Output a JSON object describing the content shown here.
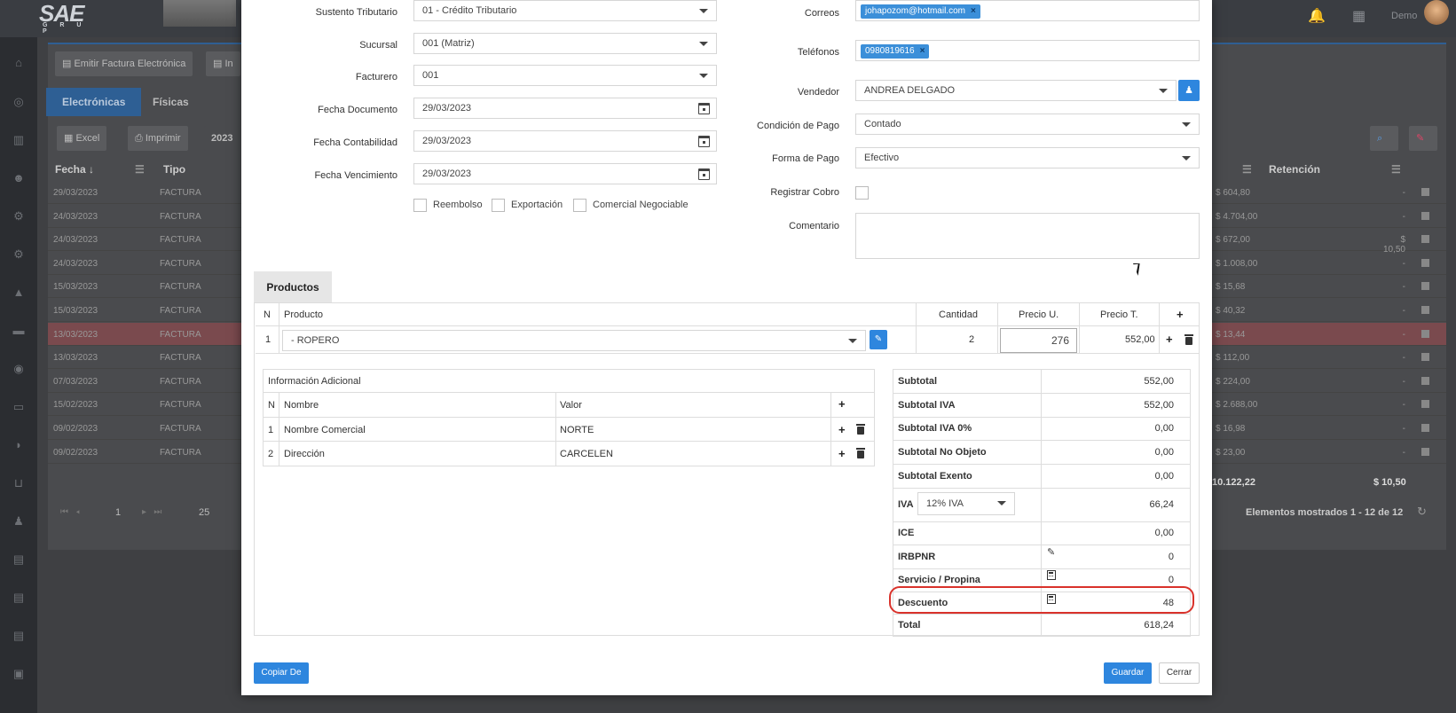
{
  "app": {
    "logo": "SAE",
    "logo_sub": "G R U P",
    "user": "Demo"
  },
  "background": {
    "buttons": [
      "Emitir Factura Electrónica",
      "In"
    ],
    "tabs": [
      "Electrónicas",
      "Físicas"
    ],
    "toolbar": [
      "Excel",
      "Imprimir",
      "2023"
    ],
    "headers": {
      "fecha": "Fecha ↓",
      "tipo": "Tipo",
      "retencion": "Retención"
    },
    "rows": [
      {
        "fecha": "29/03/2023",
        "tipo": "FACTURA",
        "total": "$ 604,80",
        "ret": "-"
      },
      {
        "fecha": "24/03/2023",
        "tipo": "FACTURA",
        "total": "$ 4.704,00",
        "ret": "-"
      },
      {
        "fecha": "24/03/2023",
        "tipo": "FACTURA",
        "total": "$ 672,00",
        "ret": "$ 10,50"
      },
      {
        "fecha": "24/03/2023",
        "tipo": "FACTURA",
        "total": "$ 1.008,00",
        "ret": "-"
      },
      {
        "fecha": "15/03/2023",
        "tipo": "FACTURA",
        "total": "$ 15,68",
        "ret": "-"
      },
      {
        "fecha": "15/03/2023",
        "tipo": "FACTURA",
        "total": "$ 40,32",
        "ret": "-"
      },
      {
        "fecha": "13/03/2023",
        "tipo": "FACTURA",
        "total": "$ 13,44",
        "ret": "-"
      },
      {
        "fecha": "13/03/2023",
        "tipo": "FACTURA",
        "total": "$ 112,00",
        "ret": "-"
      },
      {
        "fecha": "07/03/2023",
        "tipo": "FACTURA",
        "total": "$ 224,00",
        "ret": "-"
      },
      {
        "fecha": "15/02/2023",
        "tipo": "FACTURA",
        "total": "$ 2.688,00",
        "ret": "-"
      },
      {
        "fecha": "09/02/2023",
        "tipo": "FACTURA",
        "total": "$ 16,98",
        "ret": "-"
      },
      {
        "fecha": "09/02/2023",
        "tipo": "FACTURA",
        "total": "$ 23,00",
        "ret": "-"
      }
    ],
    "sum_total": "10.122,22",
    "sum_ret": "$ 10,50",
    "page": "1",
    "per_page": "25",
    "shown": "Elementos mostrados 1 - 12 de 12"
  },
  "form": {
    "left": [
      {
        "label": "Sustento Tributario",
        "value": "01 - Crédito Tributario"
      },
      {
        "label": "Sucursal",
        "value": "001 (Matriz)"
      },
      {
        "label": "Facturero",
        "value": "001"
      },
      {
        "label": "Fecha Documento",
        "value": "29/03/2023"
      },
      {
        "label": "Fecha Contabilidad",
        "value": "29/03/2023"
      },
      {
        "label": "Fecha Vencimiento",
        "value": "29/03/2023"
      }
    ],
    "checks": [
      "Reembolso",
      "Exportación",
      "Comercial Negociable"
    ],
    "correos_label": "Correos",
    "correo_chip": "johapozom@hotmail.com",
    "telefonos_label": "Teléfonos",
    "telefono_chip": "0980819616",
    "vendedor_label": "Vendedor",
    "vendedor": "ANDREA DELGADO",
    "condicion_label": "Condición de Pago",
    "condicion": "Contado",
    "forma_label": "Forma de Pago",
    "forma": "Efectivo",
    "registrar_label": "Registrar Cobro",
    "comentario_label": "Comentario"
  },
  "products": {
    "tab": "Productos",
    "headers": {
      "n": "N",
      "producto": "Producto",
      "cantidad": "Cantidad",
      "precio_u": "Precio U.",
      "precio_t": "Precio T."
    },
    "row": {
      "n": "1",
      "producto": "- ROPERO",
      "cantidad": "2",
      "precio_u": "276",
      "precio_t": "552,00"
    }
  },
  "info": {
    "title": "Información Adicional",
    "headers": {
      "n": "N",
      "nombre": "Nombre",
      "valor": "Valor"
    },
    "rows": [
      {
        "n": "1",
        "nombre": "Nombre Comercial",
        "valor": "NORTE"
      },
      {
        "n": "2",
        "nombre": "Dirección",
        "valor": "CARCELEN"
      }
    ]
  },
  "totals": {
    "subtotal": {
      "label": "Subtotal",
      "value": "552,00"
    },
    "subtotal_iva": {
      "label": "Subtotal IVA",
      "value": "552,00"
    },
    "subtotal_iva0": {
      "label": "Subtotal IVA 0%",
      "value": "0,00"
    },
    "subtotal_no": {
      "label": "Subtotal No Objeto",
      "value": "0,00"
    },
    "subtotal_ex": {
      "label": "Subtotal Exento",
      "value": "0,00"
    },
    "iva": {
      "label": "IVA",
      "select": "12% IVA",
      "value": "66,24"
    },
    "ice": {
      "label": "ICE",
      "value": "0,00"
    },
    "irbpnr": {
      "label": "IRBPNR",
      "value": "0"
    },
    "servicio": {
      "label": "Servicio / Propina",
      "value": "0"
    },
    "descuento": {
      "label": "Descuento",
      "value": "48"
    },
    "total": {
      "label": "Total",
      "value": "618,24"
    }
  },
  "footer": {
    "copiar": "Copiar De",
    "guardar": "Guardar",
    "cerrar": "Cerrar"
  }
}
